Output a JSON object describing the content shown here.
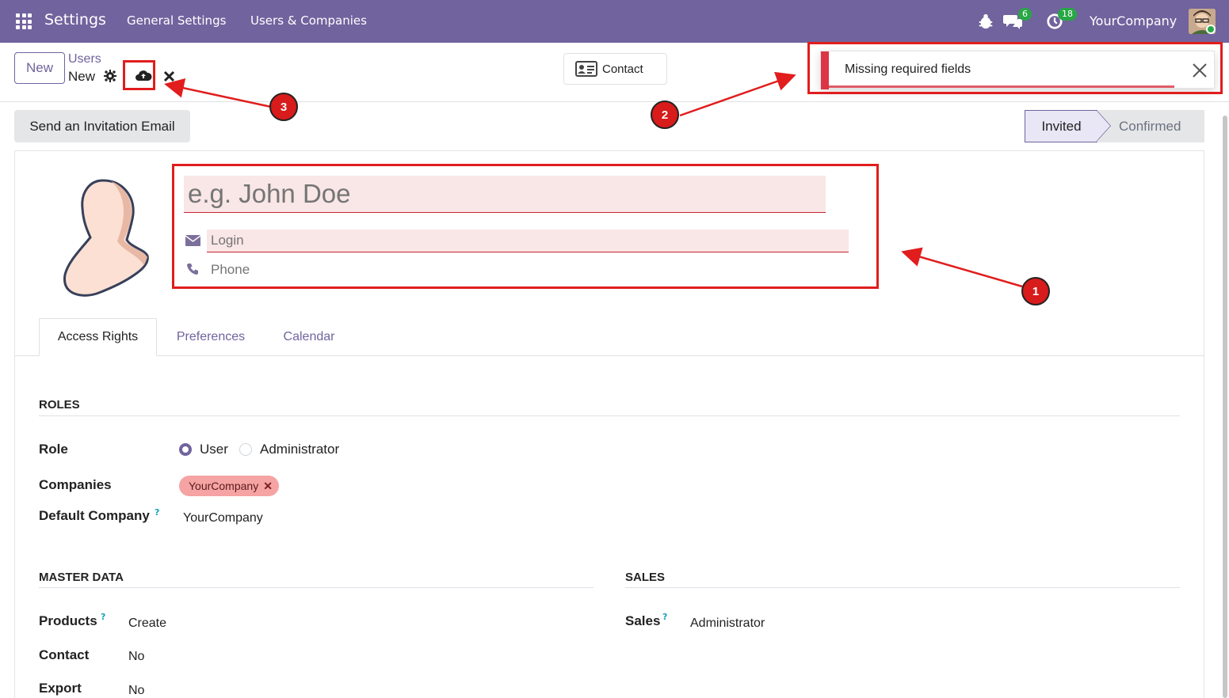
{
  "navbar": {
    "app_name": "Settings",
    "menus": [
      "General Settings",
      "Users & Companies"
    ],
    "messages_badge": "6",
    "activities_badge": "18",
    "company": "YourCompany",
    "bg_color": "#71639e"
  },
  "control_panel": {
    "new_label": "New",
    "breadcrumb_parent": "Users",
    "breadcrumb_current": "New",
    "contact_label": "Contact"
  },
  "toast": {
    "message": "Missing required fields"
  },
  "statusbar": {
    "invite_label": "Send an Invitation Email",
    "stages": [
      "Invited",
      "Confirmed"
    ],
    "current_stage": "Invited"
  },
  "form": {
    "name_placeholder": "e.g. John Doe",
    "login_placeholder": "Login",
    "phone_placeholder": "Phone"
  },
  "tabs": [
    "Access Rights",
    "Preferences",
    "Calendar"
  ],
  "roles": {
    "title": "ROLES",
    "role_label": "Role",
    "role_options": [
      "User",
      "Administrator"
    ],
    "role_selected": "User",
    "companies_label": "Companies",
    "companies_tag": "YourCompany",
    "default_company_label": "Default Company",
    "help_mark": "?",
    "default_company_value": "YourCompany"
  },
  "master_data": {
    "title": "MASTER DATA",
    "fields": [
      {
        "label": "Products",
        "value": "Create"
      },
      {
        "label": "Contact",
        "value": "No"
      },
      {
        "label": "Export",
        "value": "No"
      }
    ]
  },
  "sales": {
    "title": "SALES",
    "fields": [
      {
        "label": "Sales",
        "value": "Administrator"
      }
    ]
  },
  "annotations": [
    "1",
    "2",
    "3"
  ],
  "colors": {
    "accent": "#71639e",
    "danger": "#dc3545",
    "annotation": "#e11d1d"
  }
}
